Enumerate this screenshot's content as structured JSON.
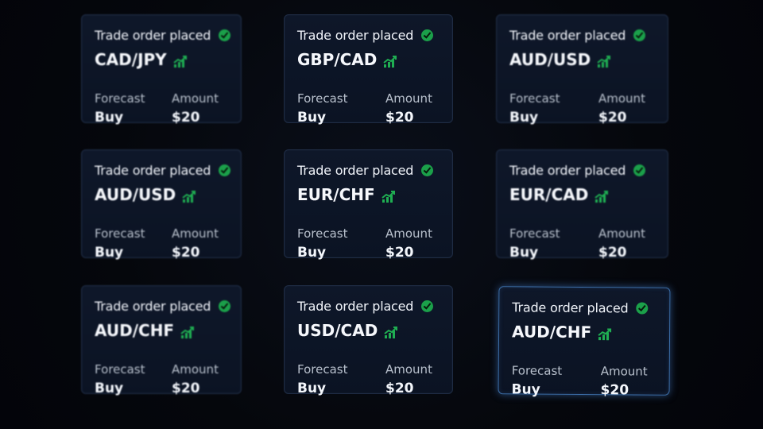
{
  "trades": [
    {
      "status": "Trade order placed",
      "pair": "CAD/JPY",
      "forecast_label": "Forecast",
      "forecast_value": "Buy",
      "amount_label": "Amount",
      "amount_value": "$20",
      "check_icon": "check-circle-icon",
      "trend_icon": "trend-up-icon"
    },
    {
      "status": "Trade order placed",
      "pair": "GBP/CAD",
      "forecast_label": "Forecast",
      "forecast_value": "Buy",
      "amount_label": "Amount",
      "amount_value": "$20",
      "check_icon": "check-circle-icon",
      "trend_icon": "trend-up-icon"
    },
    {
      "status": "Trade order placed",
      "pair": "AUD/USD",
      "forecast_label": "Forecast",
      "forecast_value": "Buy",
      "amount_label": "Amount",
      "amount_value": "$20",
      "check_icon": "check-circle-icon",
      "trend_icon": "trend-up-icon"
    },
    {
      "status": "Trade order placed",
      "pair": "AUD/USD",
      "forecast_label": "Forecast",
      "forecast_value": "Buy",
      "amount_label": "Amount",
      "amount_value": "$20",
      "check_icon": "check-circle-icon",
      "trend_icon": "trend-up-icon"
    },
    {
      "status": "Trade order placed",
      "pair": "EUR/CHF",
      "forecast_label": "Forecast",
      "forecast_value": "Buy",
      "amount_label": "Amount",
      "amount_value": "$20",
      "check_icon": "check-circle-icon",
      "trend_icon": "trend-up-icon"
    },
    {
      "status": "Trade order placed",
      "pair": "EUR/CAD",
      "forecast_label": "Forecast",
      "forecast_value": "Buy",
      "amount_label": "Amount",
      "amount_value": "$20",
      "check_icon": "check-circle-icon",
      "trend_icon": "trend-up-icon"
    },
    {
      "status": "Trade order placed",
      "pair": "AUD/CHF",
      "forecast_label": "Forecast",
      "forecast_value": "Buy",
      "amount_label": "Amount",
      "amount_value": "$20",
      "check_icon": "check-circle-icon",
      "trend_icon": "trend-up-icon"
    },
    {
      "status": "Trade order placed",
      "pair": "USD/CAD",
      "forecast_label": "Forecast",
      "forecast_value": "Buy",
      "amount_label": "Amount",
      "amount_value": "$20",
      "check_icon": "check-circle-icon",
      "trend_icon": "trend-up-icon"
    },
    {
      "status": "Trade order placed",
      "pair": "AUD/CHF",
      "forecast_label": "Forecast",
      "forecast_value": "Buy",
      "amount_label": "Amount",
      "amount_value": "$20",
      "check_icon": "check-circle-icon",
      "trend_icon": "trend-up-icon"
    }
  ],
  "colors": {
    "background": "#05070c",
    "card_background": "#0e1729",
    "card_border": "#1f2c44",
    "highlight_border": "#3c6ea8",
    "success_green": "#1ba04a",
    "trend_green": "#1fae52"
  }
}
